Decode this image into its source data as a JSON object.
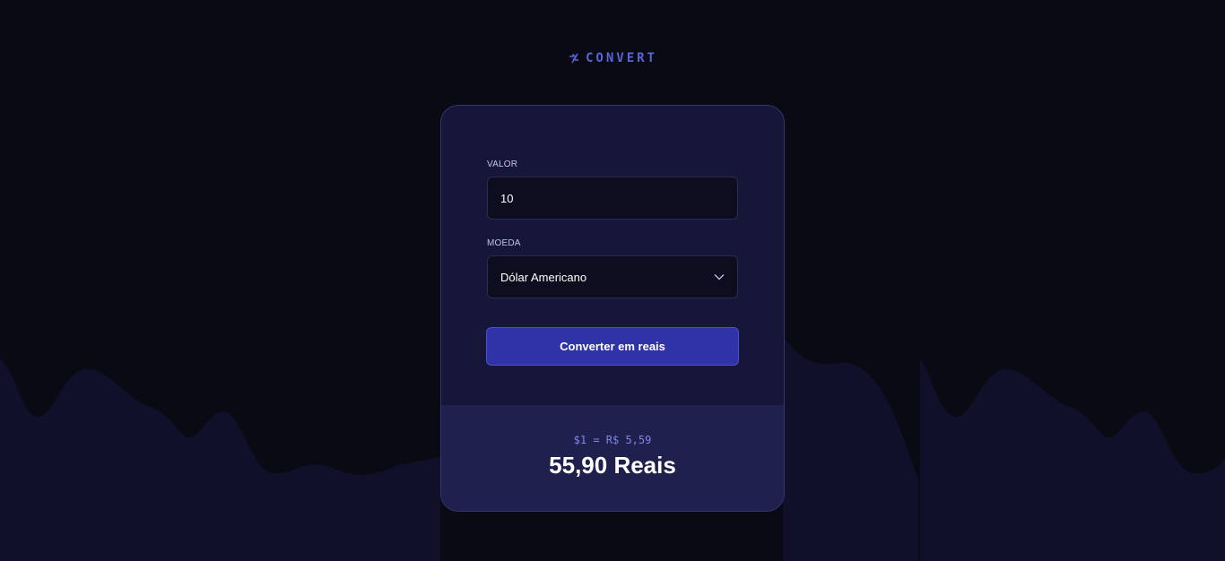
{
  "brand": {
    "name": "CONVERT",
    "icon": "arrows-exchange-icon",
    "color": "#5865d6"
  },
  "form": {
    "amount_label": "VALOR",
    "amount_value": "10",
    "currency_label": "MOEDA",
    "currency_selected": "Dólar Americano",
    "submit_label": "Converter em reais"
  },
  "result": {
    "rate": "$1 = R$ 5,59",
    "total": "55,90 Reais"
  },
  "colors": {
    "background": "#0a0a14",
    "card": "#161638",
    "result_panel": "#20204e",
    "button": "#3033a8",
    "accent": "#7e86e6"
  }
}
